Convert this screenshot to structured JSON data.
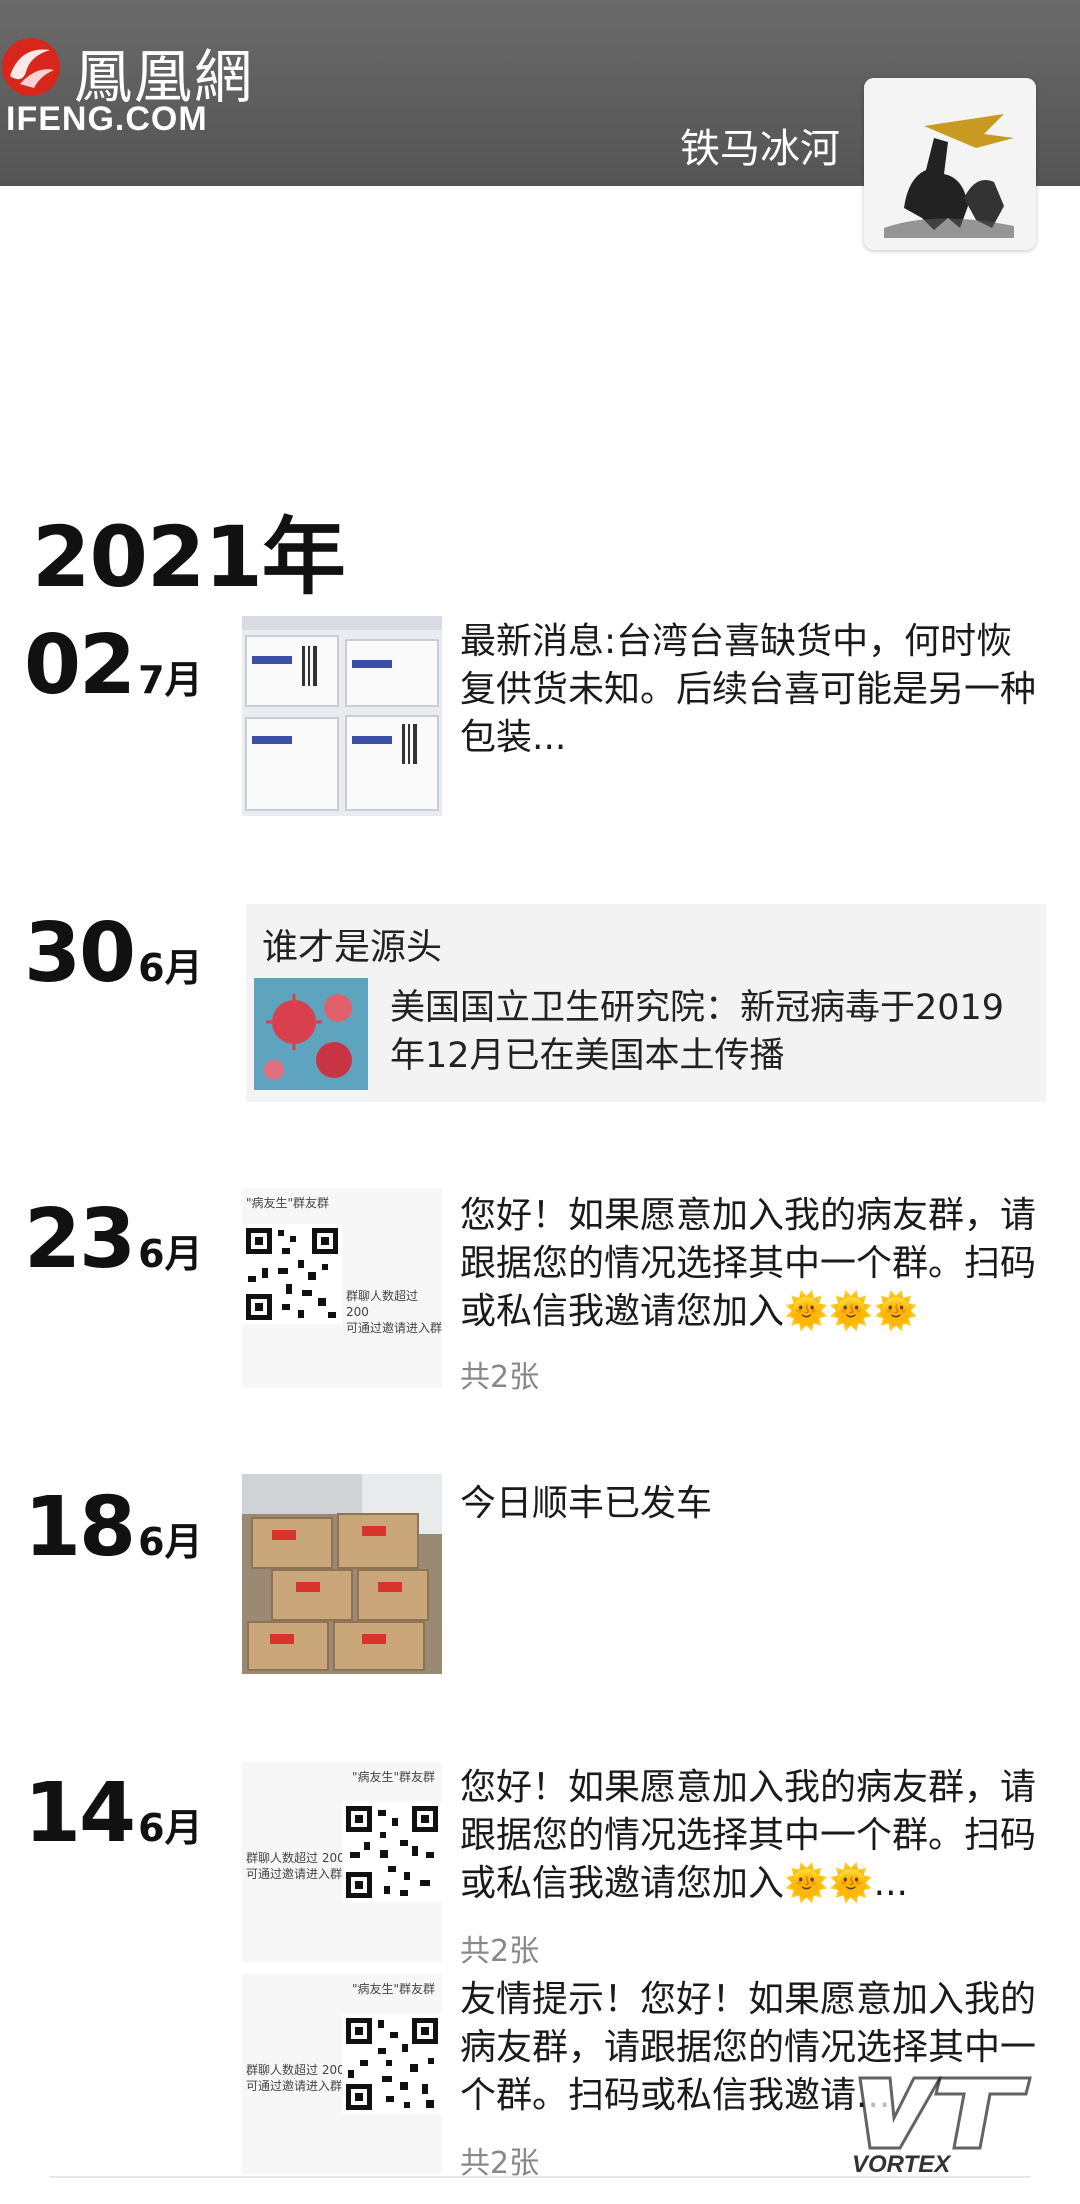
{
  "header": {
    "logo_cn": "鳳凰網",
    "logo_en": "IFENG.COM",
    "user_name": "铁马冰河"
  },
  "year_label": "2021年",
  "posts": [
    {
      "day": "02",
      "month": "7月",
      "text": "最新消息:台湾台喜缺货中，何时恢复供货未知。后续台喜可能是另一种包装..."
    },
    {
      "day": "30",
      "month": "6月",
      "share_title": "谁才是源头",
      "share_text": "美国国立卫生研究院：新冠病毒于2019年12月已在美国本土传播"
    },
    {
      "day": "23",
      "month": "6月",
      "text": "您好！如果愿意加入我的病友群，请跟据您的情况选择其中一个群。扫码或私信我邀请您加入🌞🌞🌞",
      "count": "共2张"
    },
    {
      "day": "18",
      "month": "6月",
      "text": "今日顺丰已发车"
    },
    {
      "day": "14",
      "month": "6月",
      "text": "您好！如果愿意加入我的病友群，请跟据您的情况选择其中一个群。扫码或私信我邀请您加入🌞🌞...",
      "count": "共2张"
    },
    {
      "text": "友情提示！您好！如果愿意加入我的病友群，请跟据您的情况选择其中一个群。扫码或私信我邀请...",
      "count": "共2张"
    }
  ],
  "qr_snippets": {
    "top": "\"病友生\"群友群",
    "mid": "群聊人数超过 200",
    "bottom": "可通过邀请进入群"
  },
  "watermark": "VORTEX"
}
